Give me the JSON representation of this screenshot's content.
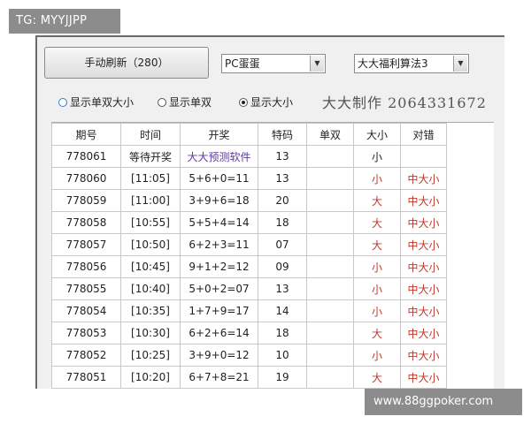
{
  "watermark_top": "TG: MYYJJPP",
  "watermark_bottom": "www.88ggpoker.com",
  "controls": {
    "refresh_label": "手动刷新（280）",
    "select1_value": "PC蛋蛋",
    "select2_value": "大大福利算法3",
    "radios": [
      {
        "label": "显示单双大小",
        "checked": false
      },
      {
        "label": "显示单双",
        "checked": false
      },
      {
        "label": "显示大小",
        "checked": true
      }
    ],
    "maker_text": "大大制作 2064331672"
  },
  "table": {
    "headers": [
      "期号",
      "时间",
      "开奖",
      "特码",
      "单双",
      "大小",
      "对错"
    ],
    "rows": [
      [
        "778061",
        "等待开奖",
        "大大预测软件",
        "13",
        "",
        "小",
        ""
      ],
      [
        "778060",
        "[11:05]",
        "5+6+0=11",
        "13",
        "",
        "小",
        "中大小"
      ],
      [
        "778059",
        "[11:00]",
        "3+9+6=18",
        "20",
        "",
        "大",
        "中大小"
      ],
      [
        "778058",
        "[10:55]",
        "5+5+4=14",
        "18",
        "",
        "大",
        "中大小"
      ],
      [
        "778057",
        "[10:50]",
        "6+2+3=11",
        "07",
        "",
        "大",
        "中大小"
      ],
      [
        "778056",
        "[10:45]",
        "9+1+2=12",
        "09",
        "",
        "小",
        "中大小"
      ],
      [
        "778055",
        "[10:40]",
        "5+0+2=07",
        "13",
        "",
        "小",
        "中大小"
      ],
      [
        "778054",
        "[10:35]",
        "1+7+9=17",
        "14",
        "",
        "小",
        "中大小"
      ],
      [
        "778053",
        "[10:30]",
        "6+2+6=14",
        "18",
        "",
        "大",
        "中大小"
      ],
      [
        "778052",
        "[10:25]",
        "3+9+0=12",
        "10",
        "",
        "小",
        "中大小"
      ],
      [
        "778051",
        "[10:20]",
        "6+7+8=21",
        "19",
        "",
        "大",
        "中大小"
      ]
    ]
  }
}
